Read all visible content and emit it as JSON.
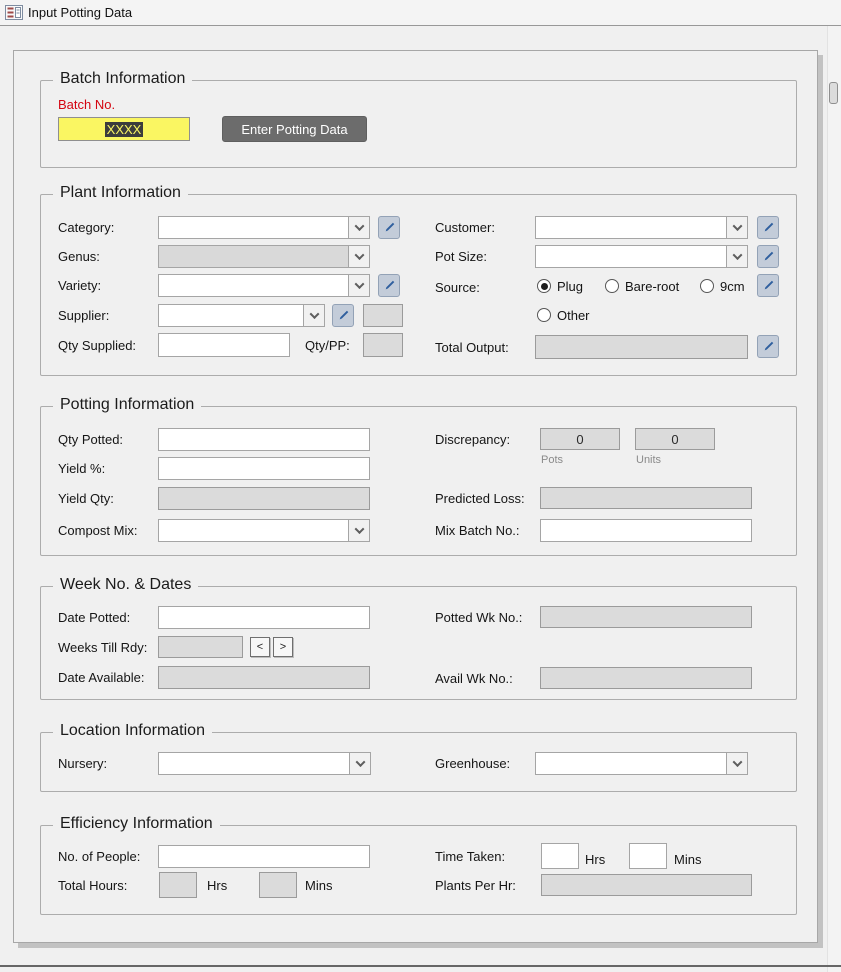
{
  "window": {
    "title": "Input Potting Data"
  },
  "batch": {
    "legend": "Batch Information",
    "batch_no_label": "Batch No.",
    "batch_no_value": "XXXX",
    "enter_button": "Enter Potting Data"
  },
  "plant": {
    "legend": "Plant Information",
    "category_label": "Category:",
    "genus_label": "Genus:",
    "variety_label": "Variety:",
    "supplier_label": "Supplier:",
    "qty_supplied_label": "Qty Supplied:",
    "qty_pp_label": "Qty/PP:",
    "customer_label": "Customer:",
    "pot_size_label": "Pot Size:",
    "source_label": "Source:",
    "total_output_label": "Total Output:",
    "source_options": {
      "plug": "Plug",
      "bare_root": "Bare-root",
      "nine_cm": "9cm",
      "other": "Other"
    },
    "source_selected": "Plug"
  },
  "potting": {
    "legend": "Potting Information",
    "qty_potted_label": "Qty Potted:",
    "yield_pct_label": "Yield %:",
    "yield_qty_label": "Yield Qty:",
    "compost_mix_label": "Compost Mix:",
    "discrepancy_label": "Discrepancy:",
    "discrepancy_pots_value": "0",
    "discrepancy_units_value": "0",
    "pots_caption": "Pots",
    "units_caption": "Units",
    "predicted_loss_label": "Predicted Loss:",
    "mix_batch_label": "Mix Batch No.:"
  },
  "weeks": {
    "legend": "Week No. & Dates",
    "date_potted_label": "Date Potted:",
    "weeks_till_rdy_label": "Weeks Till Rdy:",
    "date_available_label": "Date Available:",
    "potted_wk_label": "Potted Wk No.:",
    "avail_wk_label": "Avail Wk No.:",
    "prev_button": "<",
    "next_button": ">"
  },
  "location": {
    "legend": "Location Information",
    "nursery_label": "Nursery:",
    "greenhouse_label": "Greenhouse:"
  },
  "efficiency": {
    "legend": "Efficiency Information",
    "people_label": "No. of People:",
    "total_hours_label": "Total Hours:",
    "time_taken_label": "Time Taken:",
    "plants_per_hr_label": "Plants Per Hr:",
    "hrs_caption": "Hrs",
    "mins_caption": "Mins"
  },
  "colors": {
    "highlight_yellow": "#FAF662",
    "button_gray": "#6C6C6C",
    "label_red": "#D40511",
    "disabled_gray": "#DBDBDB",
    "pencil_blue": "#2F5F9E"
  }
}
